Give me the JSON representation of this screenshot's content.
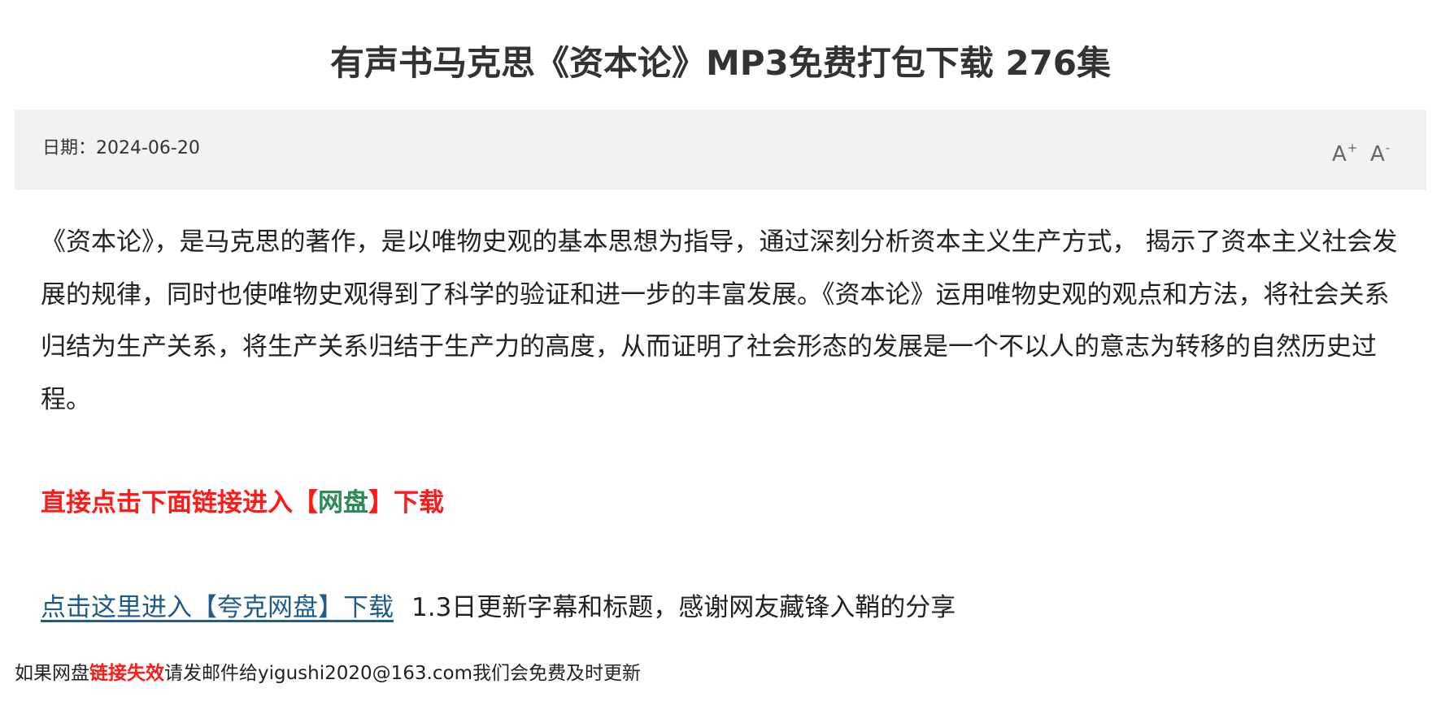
{
  "article": {
    "title": "有声书马克思《资本论》MP3免费打包下载 276集",
    "date_text": "日期：2024-06-20",
    "font_increase": "A",
    "font_increase_sign": "+",
    "font_decrease": "A",
    "font_decrease_sign": "-",
    "body": "《资本论》，是马克思的著作，是以唯物史观的基本思想为指导，通过深刻分析资本主义生产方式， 揭示了资本主义社会发展的规律，同时也使唯物史观得到了科学的验证和进一步的丰富发展。《资本论》运用唯物史观的观点和方法，将社会关系归结为生产关系，将生产关系归结于生产力的高度，从而证明了社会形态的发展是一个不以人的意志为转移的自然历史过程。"
  },
  "download": {
    "cta_prefix": "直接点击下面链接进入【",
    "cta_highlight": "网盘",
    "cta_suffix": "】下载",
    "link_label": "点击这里进入【夸克网盘】下载",
    "update_note": "1.3日更新字幕和标题，感谢网友藏锋入鞘的分享"
  },
  "footer": {
    "prefix": "如果网盘",
    "highlight": "链接失效",
    "suffix": "请发邮件给yigushi2020@163.com我们会免费及时更新"
  },
  "colors": {
    "accent_red": "#ff1a1a",
    "accent_green": "#2e8b57",
    "link_blue": "#1f5a8b",
    "meta_bg": "#f2f2f2"
  }
}
